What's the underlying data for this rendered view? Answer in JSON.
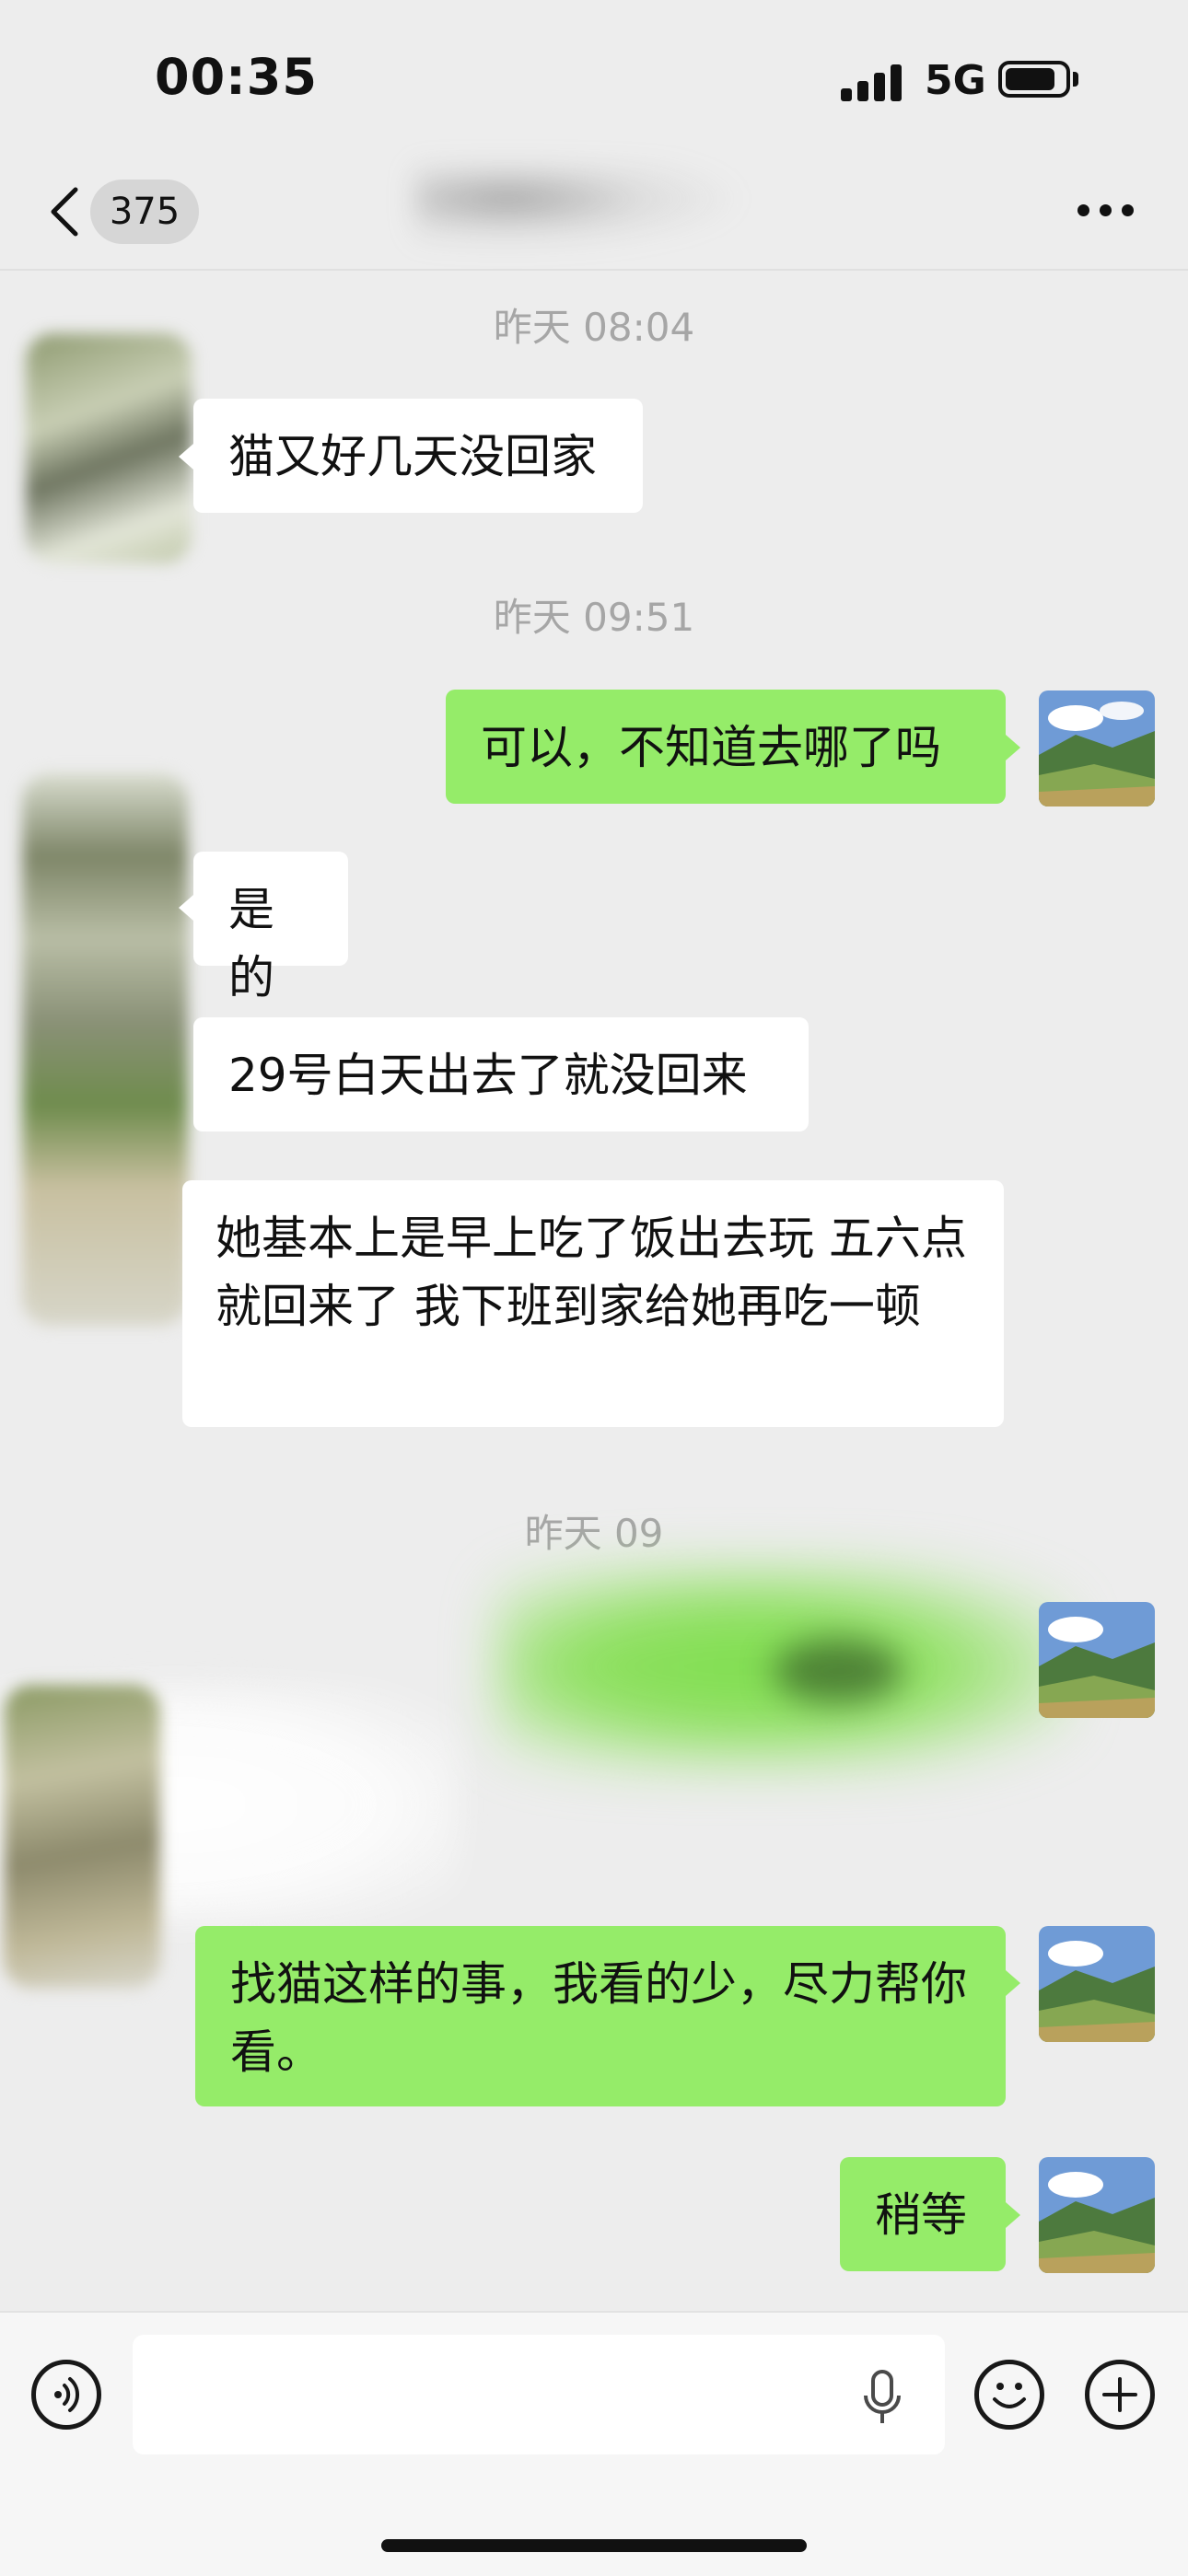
{
  "status_bar": {
    "time": "00:35",
    "network": "5G",
    "battery_level": 0.85
  },
  "nav": {
    "unread_count": "375"
  },
  "messages": [
    {
      "kind": "timestamp",
      "text": "昨天 08:04"
    },
    {
      "kind": "incoming",
      "text": "猫又好几天没回家"
    },
    {
      "kind": "timestamp",
      "text": "昨天 09:51"
    },
    {
      "kind": "outgoing",
      "text": "可以，不知道去哪了吗"
    },
    {
      "kind": "incoming",
      "text": "是的"
    },
    {
      "kind": "incoming",
      "text": "29号白天出去了就没回来"
    },
    {
      "kind": "incoming",
      "text": "她基本上是早上吃了饭出去玩 五六点就回来了 我下班到家给她再吃一顿"
    },
    {
      "kind": "timestamp",
      "text": "昨天 09"
    },
    {
      "kind": "outgoing",
      "text": "找猫这样的事，我看的少，尽力帮你看。"
    },
    {
      "kind": "outgoing",
      "text": "稍等"
    }
  ],
  "colors": {
    "outgoing_bubble": "#95ec69",
    "incoming_bubble": "#ffffff",
    "chat_background": "#ededed"
  },
  "icons": [
    "back-icon",
    "more-icon",
    "voice-icon",
    "microphone-icon",
    "emoji-icon",
    "plus-icon"
  ]
}
